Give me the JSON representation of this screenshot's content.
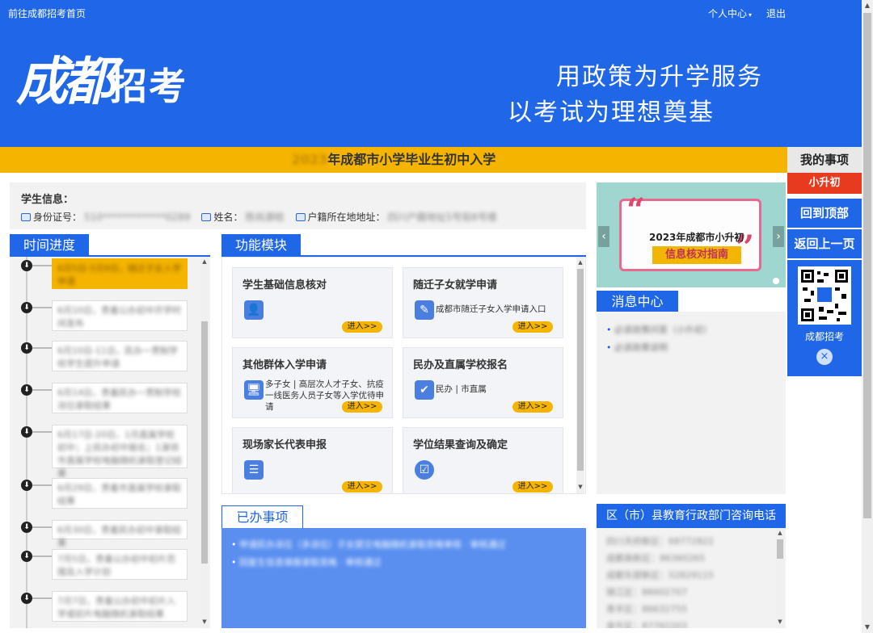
{
  "topbar": {
    "home_link": "前往成都招考首页",
    "user_center": "个人中心",
    "logout": "退出"
  },
  "banner": {
    "logo_big": "成都",
    "logo_small": "招考",
    "slogan1": "用政策为升学服务",
    "slogan2": "以考试为理想奠基"
  },
  "title": {
    "year_blurred": "2023",
    "text": "年成都市小学毕业生初中入学"
  },
  "student": {
    "heading": "学生信息：",
    "id_label": "身份证号：",
    "id_value": "510*************0289",
    "name_label": "姓名：",
    "name_value": "陈尚源晗",
    "addr_label": "户籍所在地地址：",
    "addr_value": "四川户籍地址5号街8号楼"
  },
  "timeline": {
    "heading": "时间进度",
    "items": [
      "6月5日-5月9日，随迁子女入学申请",
      "6月10日，贵着公办初中开学时间发布",
      "6月10日-11日，民办一贯制学校学生提升申请",
      "6月14日，贵着民办一贯制学校派位录取结果",
      "6月17日-20日，1月直属学校初中；上民办初中报名；1演领市直属学校电脑随机录取登记结果",
      "6月29日，贵着市直属学校录取结果",
      "6月30日，贵着民办初中录取结果",
      "7月5日，贵着公办初中初片范围及入学计划",
      "7月7日，贵着公办初中初片入学或初片电脑随机录取结果"
    ]
  },
  "functions": {
    "heading": "功能模块",
    "enter_label": "进入>>",
    "cards": [
      {
        "name": "学生基础信息核对",
        "desc": ""
      },
      {
        "name": "随迁子女就学申请",
        "desc": "成都市随迁子女入学申请入口"
      },
      {
        "name": "其他群体入学申请",
        "desc": "多子女 | 高层次人才子女、抗疫一线医务人员子女等入学优待申请"
      },
      {
        "name": "民办及直属学校报名",
        "desc": "民办 | 市直属"
      },
      {
        "name": "现场家长代表申报",
        "desc": ""
      },
      {
        "name": "学位结果查询及确定",
        "desc": ""
      }
    ]
  },
  "done": {
    "heading": "已办事项",
    "items": [
      "申请民办派位（多派位）子女提交电脑随机录取资格审核 · 审核通过",
      "回复生信息填报录取资格 · 审核通过"
    ]
  },
  "carousel": {
    "line1": "2023年成都市小升初",
    "line2": "信息核对指南"
  },
  "messages": {
    "heading": "消息中心",
    "items": [
      "必读政策问答（小升初）",
      "必读政策说明"
    ]
  },
  "phones": {
    "heading": "区（市）县教育行政部门咨询电话",
    "items": [
      "四川天府新区：68772822",
      "成都高新区：86360265",
      "成都东部新区：52829115",
      "锦江区：86602707",
      "青羊区：86632755",
      "金牛区：87792203"
    ]
  },
  "side": {
    "heading": "我的事项",
    "tag": "小升初",
    "back_top": "回到顶部",
    "back_prev": "返回上一页",
    "qr_caption": "成都招考",
    "close": "×"
  }
}
